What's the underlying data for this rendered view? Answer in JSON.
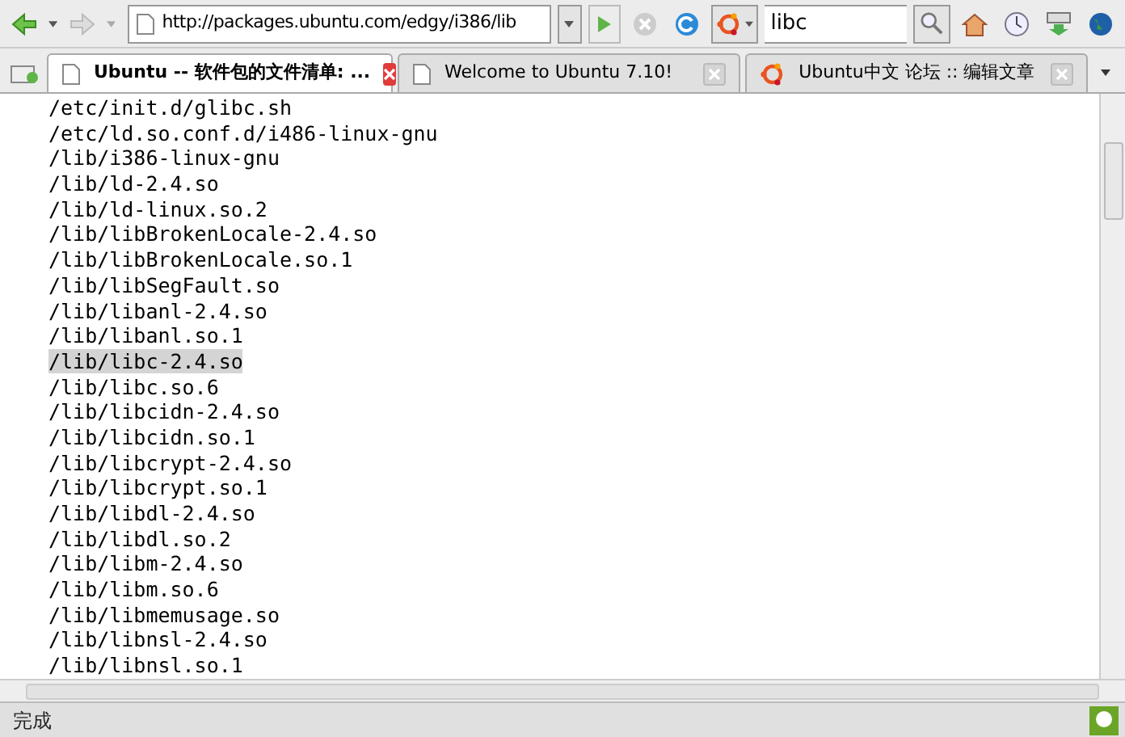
{
  "toolbar": {
    "url": "http://packages.ubuntu.com/edgy/i386/lib",
    "search": "libc"
  },
  "tabs": [
    {
      "label": "Ubuntu -- 软件包的文件清单: ...",
      "selected": true,
      "kind": "page"
    },
    {
      "label": "Welcome to Ubuntu 7.10!",
      "selected": false,
      "kind": "page"
    },
    {
      "label": "Ubuntu中文 论坛 :: 编辑文章",
      "selected": false,
      "kind": "ubuntu"
    }
  ],
  "lines": [
    {
      "text": "/etc/init.d/glibc.sh",
      "selected": false
    },
    {
      "text": "/etc/ld.so.conf.d/i486-linux-gnu",
      "selected": false
    },
    {
      "text": "/lib/i386-linux-gnu",
      "selected": false
    },
    {
      "text": "/lib/ld-2.4.so",
      "selected": false
    },
    {
      "text": "/lib/ld-linux.so.2",
      "selected": false
    },
    {
      "text": "/lib/libBrokenLocale-2.4.so",
      "selected": false
    },
    {
      "text": "/lib/libBrokenLocale.so.1",
      "selected": false
    },
    {
      "text": "/lib/libSegFault.so",
      "selected": false
    },
    {
      "text": "/lib/libanl-2.4.so",
      "selected": false
    },
    {
      "text": "/lib/libanl.so.1",
      "selected": false
    },
    {
      "text": "/lib/libc-2.4.so",
      "selected": true
    },
    {
      "text": "/lib/libc.so.6",
      "selected": false
    },
    {
      "text": "/lib/libcidn-2.4.so",
      "selected": false
    },
    {
      "text": "/lib/libcidn.so.1",
      "selected": false
    },
    {
      "text": "/lib/libcrypt-2.4.so",
      "selected": false
    },
    {
      "text": "/lib/libcrypt.so.1",
      "selected": false
    },
    {
      "text": "/lib/libdl-2.4.so",
      "selected": false
    },
    {
      "text": "/lib/libdl.so.2",
      "selected": false
    },
    {
      "text": "/lib/libm-2.4.so",
      "selected": false
    },
    {
      "text": "/lib/libm.so.6",
      "selected": false
    },
    {
      "text": "/lib/libmemusage.so",
      "selected": false
    },
    {
      "text": "/lib/libnsl-2.4.so",
      "selected": false
    },
    {
      "text": "/lib/libnsl.so.1",
      "selected": false
    }
  ],
  "status_bar": {
    "text": "完成"
  }
}
